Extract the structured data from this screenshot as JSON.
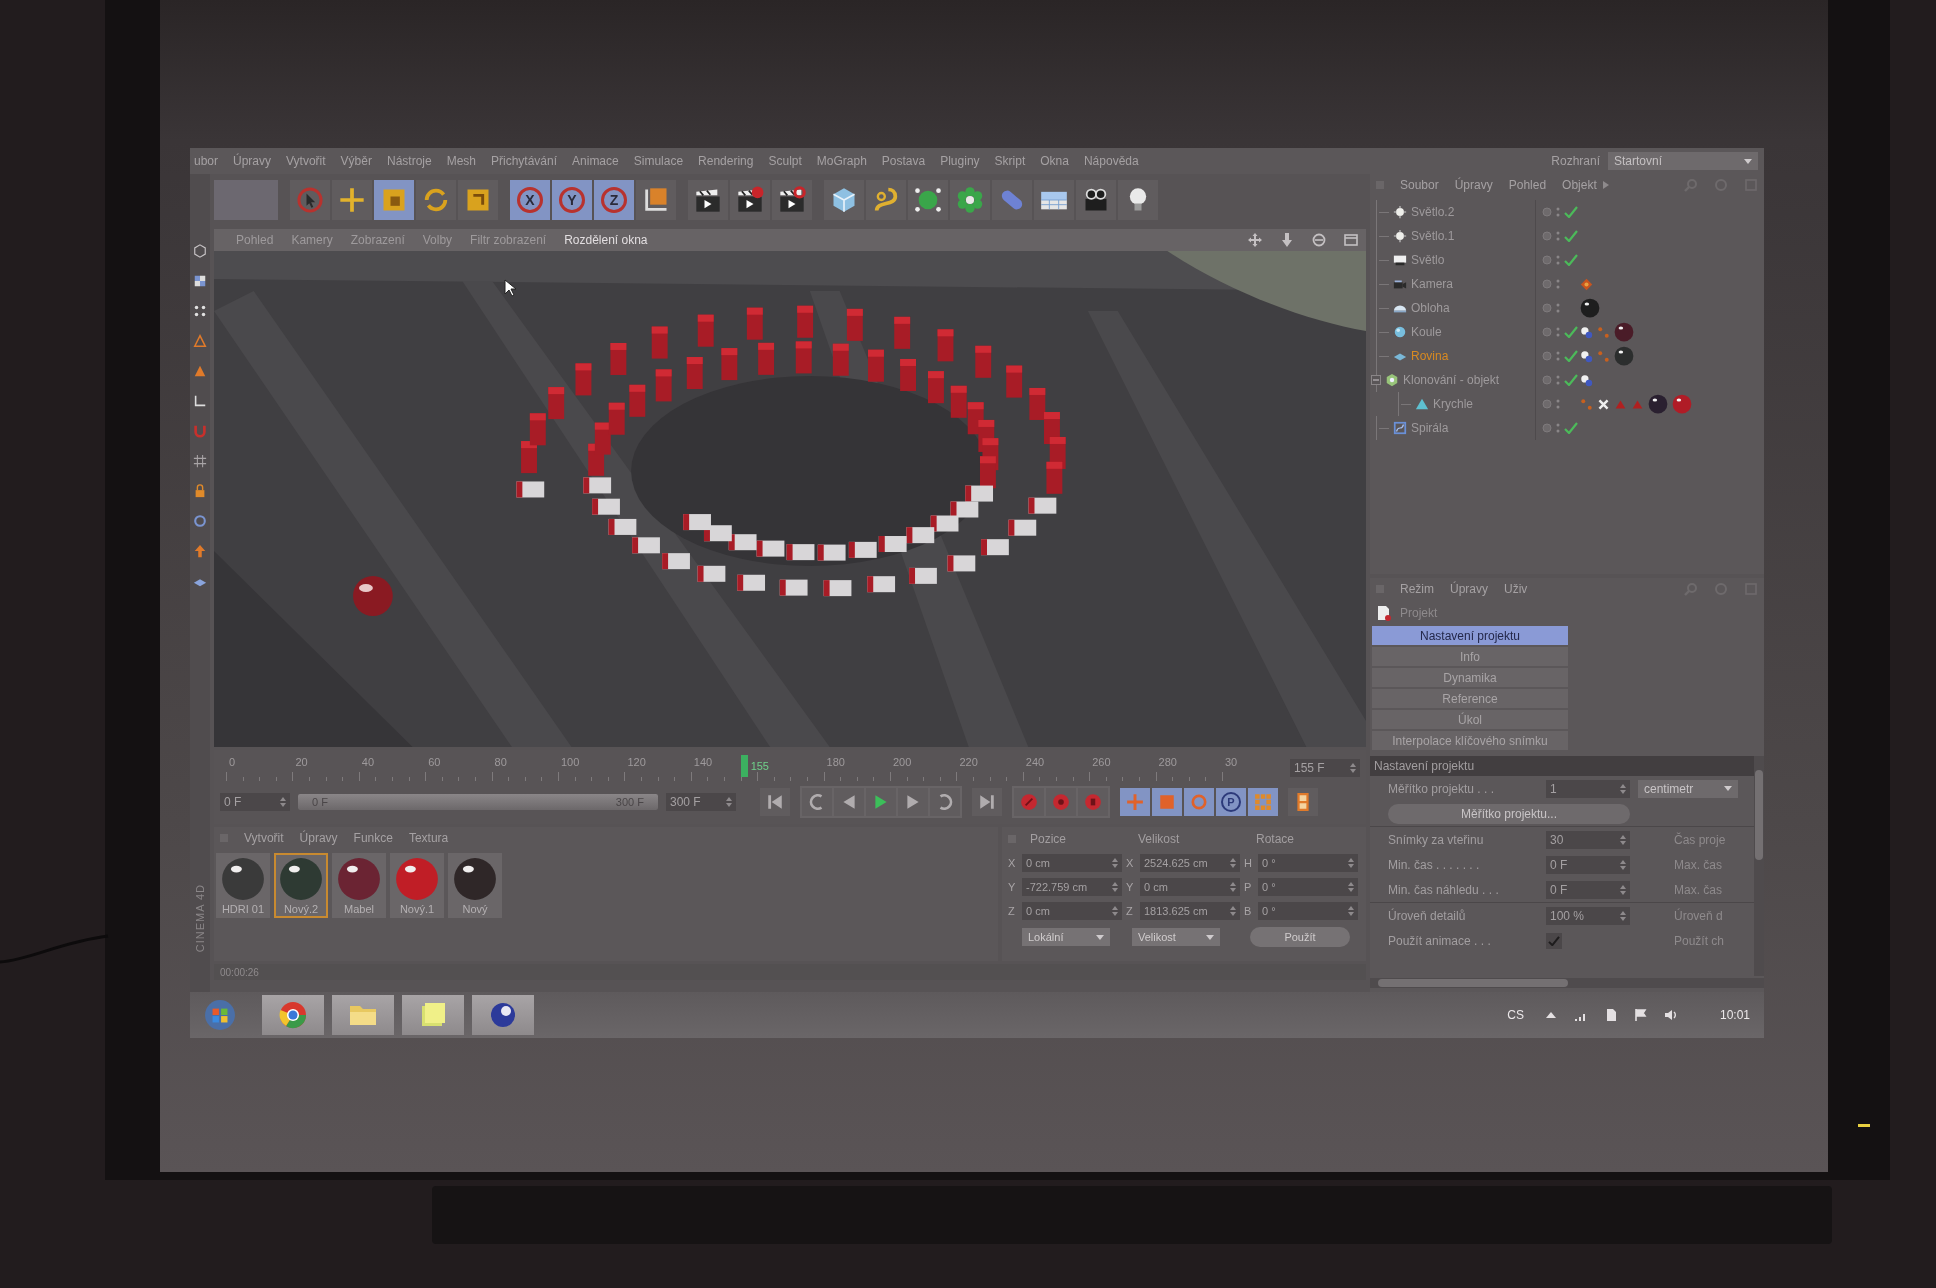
{
  "menu_bar": {
    "items": [
      "ubor",
      "Úpravy",
      "Vytvořit",
      "Výběr",
      "Nástroje",
      "Mesh",
      "Přichytávání",
      "Animace",
      "Simulace",
      "Rendering",
      "Sculpt",
      "MoGraph",
      "Postava",
      "Pluginy",
      "Skript",
      "Okna",
      "Nápověda"
    ],
    "layout_label": "Rozhraní",
    "layout_value": "Startovní"
  },
  "toolbar": {
    "groups": [
      [
        {
          "kind": "blank",
          "active": false
        }
      ],
      [
        {
          "kind": "select",
          "active": false
        },
        {
          "kind": "move",
          "active": false
        },
        {
          "kind": "scale",
          "active": true
        },
        {
          "kind": "rotate",
          "active": false
        },
        {
          "kind": "recent",
          "active": false
        }
      ],
      [
        {
          "kind": "axis",
          "label": "X",
          "active": true
        },
        {
          "kind": "axis",
          "label": "Y",
          "active": true
        },
        {
          "kind": "axis",
          "label": "Z",
          "active": true
        },
        {
          "kind": "coords",
          "active": false
        }
      ],
      [
        {
          "kind": "render-view",
          "active": false
        },
        {
          "kind": "render-picture",
          "active": false
        },
        {
          "kind": "render-settings",
          "active": false
        }
      ],
      [
        {
          "kind": "cube",
          "active": false
        },
        {
          "kind": "spline",
          "active": false
        },
        {
          "kind": "nurbs",
          "active": false
        },
        {
          "kind": "array",
          "active": false
        },
        {
          "kind": "deformer",
          "active": false
        },
        {
          "kind": "scene",
          "active": false
        },
        {
          "kind": "camera",
          "active": false
        },
        {
          "kind": "light",
          "active": false
        }
      ]
    ]
  },
  "viewport": {
    "tabs": [
      {
        "label": "Pohled",
        "highlighted": false
      },
      {
        "label": "Kamery",
        "highlighted": false
      },
      {
        "label": "Zobrazení",
        "highlighted": false
      },
      {
        "label": "Volby",
        "highlighted": false
      },
      {
        "label": "Filtr zobrazení",
        "highlighted": false
      },
      {
        "label": "Rozdělení okna",
        "highlighted": true
      }
    ]
  },
  "object_manager": {
    "menu": [
      "Soubor",
      "Úpravy",
      "Pohled",
      "Objekt"
    ],
    "objects": [
      {
        "name": "Světlo.2",
        "kind": "light",
        "selected": false,
        "checked": true
      },
      {
        "name": "Světlo.1",
        "kind": "light",
        "selected": false,
        "checked": true
      },
      {
        "name": "Světlo",
        "kind": "area-light",
        "selected": false,
        "checked": true
      },
      {
        "name": "Kamera",
        "kind": "camera",
        "selected": false,
        "checked": false,
        "tags": [
          {
            "kind": "target"
          }
        ]
      },
      {
        "name": "Obloha",
        "kind": "sky",
        "selected": false,
        "checked": false,
        "tags": [
          {
            "kind": "material",
            "color": "#1e1e1e"
          }
        ]
      },
      {
        "name": "Koule",
        "kind": "sphere",
        "selected": false,
        "checked": true,
        "tags": [
          {
            "kind": "body"
          },
          {
            "kind": "dots"
          },
          {
            "kind": "material",
            "color": "#4a1c28"
          }
        ]
      },
      {
        "name": "Rovina",
        "kind": "plane",
        "selected": true,
        "checked": true,
        "tags": [
          {
            "kind": "body"
          },
          {
            "kind": "dots"
          },
          {
            "kind": "material",
            "color": "#2c2e2e"
          }
        ]
      },
      {
        "name": "Klonování - objekt",
        "kind": "cloner",
        "selected": false,
        "checked": true,
        "expanded": true,
        "tags": [
          {
            "kind": "body"
          }
        ],
        "children": [
          {
            "name": "Krychle",
            "kind": "polygon",
            "selected": false,
            "checked": false,
            "tags": [
              {
                "kind": "dots"
              },
              {
                "kind": "cross"
              },
              {
                "kind": "triangle"
              },
              {
                "kind": "triangle"
              },
              {
                "kind": "material",
                "color": "#2a2030"
              },
              {
                "kind": "material",
                "color": "#b01c26"
              }
            ]
          }
        ]
      },
      {
        "name": "Spirála",
        "kind": "spline",
        "selected": false,
        "checked": true
      }
    ]
  },
  "attributes": {
    "menu": [
      "Režim",
      "Úpravy",
      "Uživ"
    ],
    "title": "Projekt",
    "tabs": [
      {
        "label": "Nastavení projektu",
        "selected": true
      },
      {
        "label": "Info",
        "selected": false
      },
      {
        "label": "Dynamika",
        "selected": false
      },
      {
        "label": "Reference",
        "selected": false
      },
      {
        "label": "Úkol",
        "selected": false
      },
      {
        "label": "Interpolace klíčového snímku",
        "selected": false
      }
    ],
    "section": "Nastavení projektu",
    "rows": [
      {
        "kind": "field-dropdown",
        "label": "Měřítko projektu . . .",
        "value": "1",
        "option": "centimetr"
      },
      {
        "kind": "button",
        "label": "Měřítko projektu..."
      },
      {
        "kind": "field",
        "label": "Snímky za vteřinu",
        "value": "30",
        "side": "Čas proje"
      },
      {
        "kind": "field",
        "label": "Min. čas . . . . . . .",
        "value": "0 F",
        "side": "Max. čas"
      },
      {
        "kind": "field",
        "label": "Min. čas náhledu . . .",
        "value": "0 F",
        "side": "Max. čas"
      },
      {
        "kind": "field",
        "label": "Úroveň detailů",
        "value": "100 %",
        "side": "Úroveň d"
      },
      {
        "kind": "checkbox",
        "label": "Použít animace . . .",
        "checked": true,
        "side": "Použít ch"
      }
    ]
  },
  "timeline": {
    "ruler": [
      "0",
      "20",
      "40",
      "60",
      "80",
      "100",
      "120",
      "140",
      "180",
      "200",
      "220",
      "240",
      "260",
      "280",
      "30"
    ],
    "current_label": "155",
    "level": 0.5167,
    "frame_field": "155 F",
    "start_field": "0 F",
    "range": {
      "start": "0 F",
      "end": "300 F",
      "level": 1
    },
    "end_field": "300 F",
    "key_buttons": [
      {
        "kind": "move",
        "active": true
      },
      {
        "kind": "scale",
        "active": true
      },
      {
        "kind": "rotate",
        "active": true
      },
      {
        "kind": "param",
        "label": "P",
        "active": true
      },
      {
        "kind": "grid",
        "active": true
      }
    ]
  },
  "materials": {
    "menu": [
      "Vytvořit",
      "Úpravy",
      "Funkce",
      "Textura"
    ],
    "logo": "CINEMA 4D",
    "items": [
      {
        "name": "HDRI 01",
        "color": "#3a3a3a",
        "selected": false
      },
      {
        "name": "Nový.2",
        "color": "#2e3a33",
        "selected": true
      },
      {
        "name": "Mabel",
        "color": "#6b2433",
        "selected": false
      },
      {
        "name": "Nový.1",
        "color": "#c01e26",
        "selected": false
      },
      {
        "name": "Nový",
        "color": "#2f2728",
        "selected": false
      }
    ]
  },
  "coordinates": {
    "headers": [
      "Pozice",
      "Velikost",
      "Rotace"
    ],
    "rows": [
      [
        {
          "axis": "X",
          "value": "0 cm"
        },
        {
          "axis": "X",
          "value": "2524.625 cm"
        },
        {
          "axis": "H",
          "value": "0 °"
        }
      ],
      [
        {
          "axis": "Y",
          "value": "-722.759 cm"
        },
        {
          "axis": "Y",
          "value": "0 cm"
        },
        {
          "axis": "P",
          "value": "0 °"
        }
      ],
      [
        {
          "axis": "Z",
          "value": "0 cm"
        },
        {
          "axis": "Z",
          "value": "1813.625 cm"
        },
        {
          "axis": "B",
          "value": "0 °"
        }
      ]
    ],
    "dropdowns": [
      "Lokální",
      "Velikost"
    ],
    "apply": "Použít"
  },
  "status_bar": {
    "text": "00:00:26"
  },
  "taskbar": {
    "apps": [
      {
        "kind": "browser",
        "running": true
      },
      {
        "kind": "folder",
        "running": true
      },
      {
        "kind": "notes",
        "running": true
      },
      {
        "kind": "cinema",
        "running": true
      }
    ],
    "language": "CS",
    "time": "10:01"
  }
}
